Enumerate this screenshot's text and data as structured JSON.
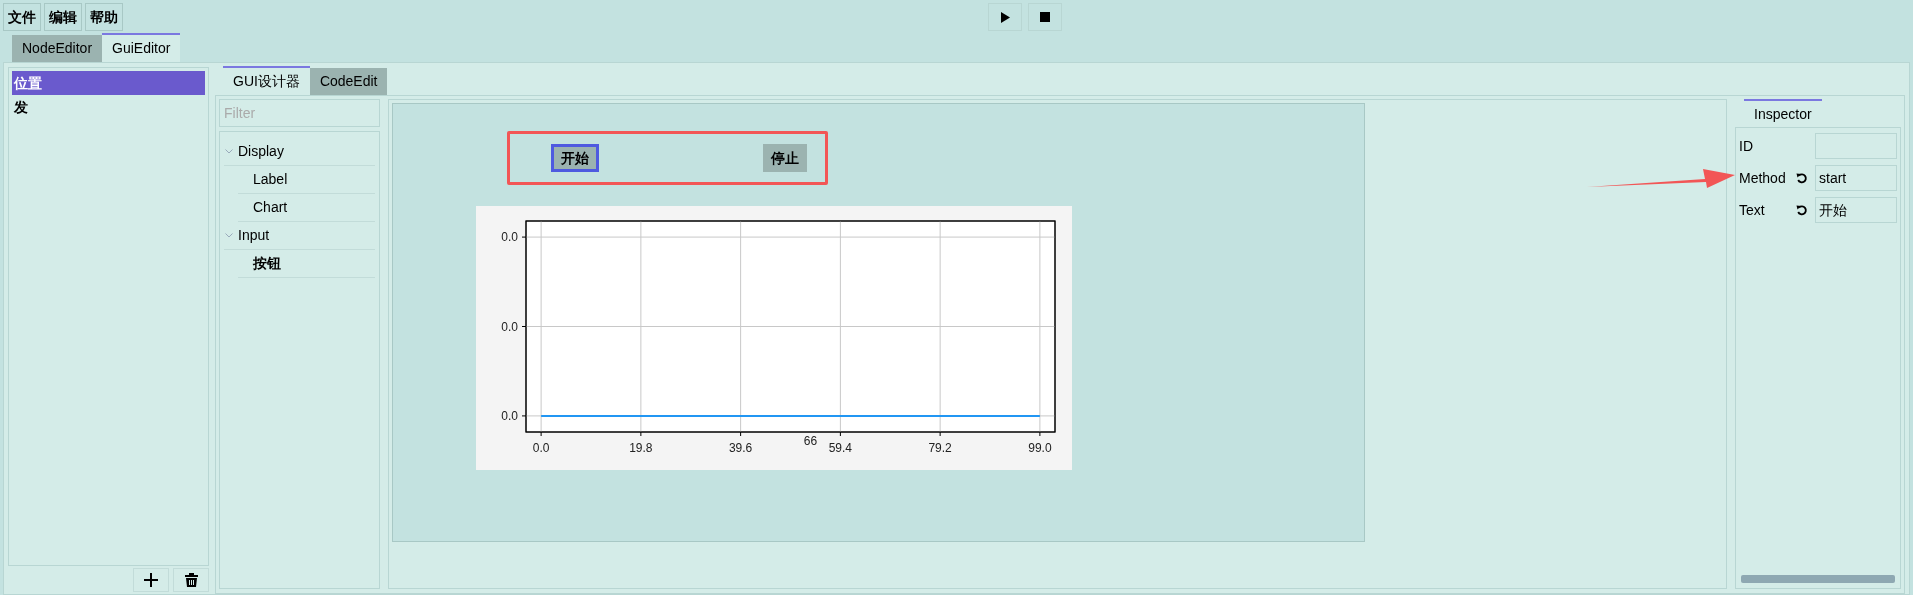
{
  "menu": [
    "文件",
    "编辑",
    "帮助"
  ],
  "main_tabs": [
    {
      "label": "NodeEditor",
      "selected": false
    },
    {
      "label": "GuiEditor",
      "selected": true
    }
  ],
  "page_list": [
    {
      "label": "位置",
      "selected": true
    },
    {
      "label": "发",
      "selected": false
    }
  ],
  "editor_tabs": [
    {
      "label": "GUI设计器",
      "selected": true
    },
    {
      "label": "CodeEdit",
      "selected": false
    }
  ],
  "palette": {
    "filter_placeholder": "Filter",
    "tree": [
      {
        "label": "Display",
        "expanded": true,
        "children": [
          {
            "label": "Label",
            "selected": false
          },
          {
            "label": "Chart",
            "selected": false
          }
        ]
      },
      {
        "label": "Input",
        "expanded": true,
        "children": [
          {
            "label": "按钮",
            "selected": true
          }
        ]
      }
    ]
  },
  "canvas": {
    "widgets": [
      {
        "kind": "button",
        "label": "开始",
        "selected": true
      },
      {
        "kind": "button",
        "label": "停止",
        "selected": false
      }
    ],
    "chart": {
      "chart_data": {
        "type": "line",
        "grid": true,
        "xlabel": "66",
        "x": [
          0,
          99
        ],
        "series": [
          {
            "color": "#2196f3",
            "values": [
              0,
              0
            ]
          }
        ],
        "xlim": [
          -3,
          102
        ],
        "ylim": [
          -0.0036,
          0.0436
        ],
        "xticks": [
          {
            "value": 0,
            "label": "0.0"
          },
          {
            "value": 19.8,
            "label": "19.8"
          },
          {
            "value": 39.6,
            "label": "39.6"
          },
          {
            "value": 59.4,
            "label": "59.4"
          },
          {
            "value": 79.2,
            "label": "79.2"
          },
          {
            "value": 99,
            "label": "99.0"
          }
        ],
        "yticks": [
          {
            "value": 0,
            "label": "0.0"
          },
          {
            "value": 0.02,
            "label": "0.0"
          },
          {
            "value": 0.04,
            "label": "0.0"
          }
        ]
      }
    }
  },
  "inspector": {
    "tab": "Inspector",
    "rows": [
      {
        "label": "ID",
        "resettable": false
      },
      {
        "label": "Method",
        "resettable": true,
        "value": "start"
      },
      {
        "label": "Text",
        "resettable": true,
        "value": "开始"
      }
    ]
  }
}
